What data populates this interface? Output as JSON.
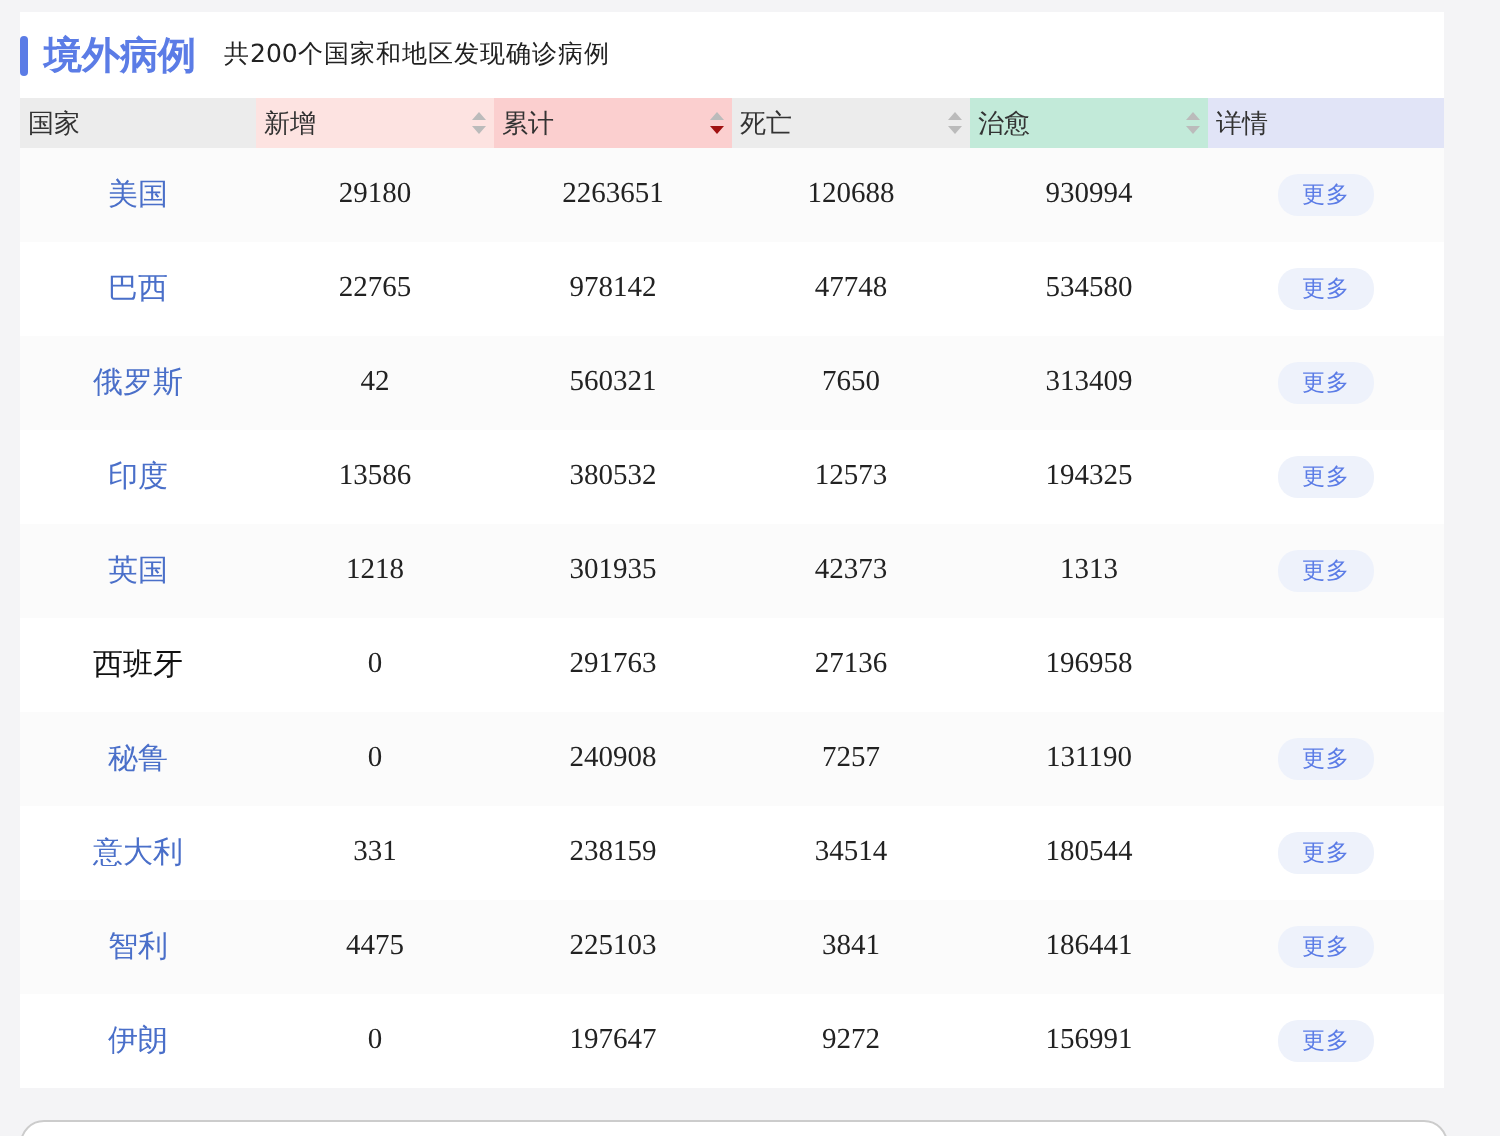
{
  "section": {
    "title": "境外病例",
    "subtitle": "共200个国家和地区发现确诊病例"
  },
  "columns": [
    {
      "label": "国家",
      "color": "#ececec",
      "sortable": false
    },
    {
      "label": "新增",
      "color": "#fde3e1",
      "sortable": true,
      "sorted": false
    },
    {
      "label": "累计",
      "color": "#fbcfcf",
      "sortable": true,
      "sorted": true
    },
    {
      "label": "死亡",
      "color": "#ececec",
      "sortable": true,
      "sorted": false
    },
    {
      "label": "治愈",
      "color": "#c2ead9",
      "sortable": true,
      "sorted": false
    },
    {
      "label": "详情",
      "color": "#e1e4f7",
      "sortable": false
    }
  ],
  "rows": [
    {
      "country": "美国",
      "linked": true,
      "new": "29180",
      "total": "2263651",
      "deaths": "120688",
      "recovered": "930994",
      "more": "更多"
    },
    {
      "country": "巴西",
      "linked": true,
      "new": "22765",
      "total": "978142",
      "deaths": "47748",
      "recovered": "534580",
      "more": "更多"
    },
    {
      "country": "俄罗斯",
      "linked": true,
      "new": "42",
      "total": "560321",
      "deaths": "7650",
      "recovered": "313409",
      "more": "更多"
    },
    {
      "country": "印度",
      "linked": true,
      "new": "13586",
      "total": "380532",
      "deaths": "12573",
      "recovered": "194325",
      "more": "更多"
    },
    {
      "country": "英国",
      "linked": true,
      "new": "1218",
      "total": "301935",
      "deaths": "42373",
      "recovered": "1313",
      "more": "更多"
    },
    {
      "country": "西班牙",
      "linked": false,
      "new": "0",
      "total": "291763",
      "deaths": "27136",
      "recovered": "196958"
    },
    {
      "country": "秘鲁",
      "linked": true,
      "new": "0",
      "total": "240908",
      "deaths": "7257",
      "recovered": "131190",
      "more": "更多"
    },
    {
      "country": "意大利",
      "linked": true,
      "new": "331",
      "total": "238159",
      "deaths": "34514",
      "recovered": "180544",
      "more": "更多"
    },
    {
      "country": "智利",
      "linked": true,
      "new": "4475",
      "total": "225103",
      "deaths": "3841",
      "recovered": "186441",
      "more": "更多"
    },
    {
      "country": "伊朗",
      "linked": true,
      "new": "0",
      "total": "197647",
      "deaths": "9272",
      "recovered": "156991",
      "more": "更多"
    }
  ]
}
